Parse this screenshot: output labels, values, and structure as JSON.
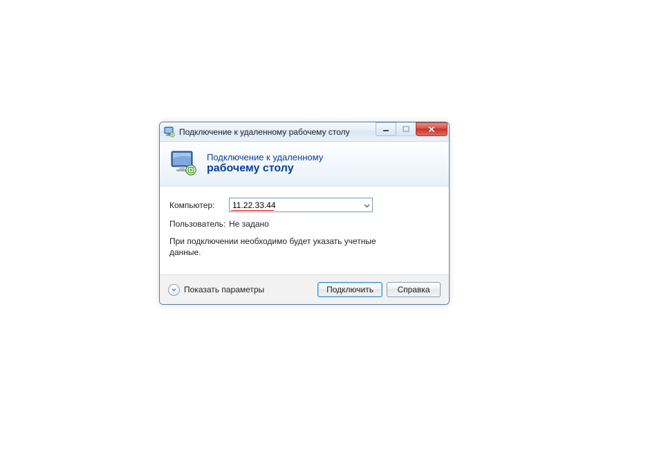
{
  "titlebar": {
    "title": "Подключение к удаленному рабочему столу"
  },
  "header": {
    "line1": "Подключение к удаленному",
    "line2": "рабочему столу"
  },
  "form": {
    "computer_label": "Компьютер:",
    "computer_value": "11.22.33.44",
    "user_label": "Пользователь:",
    "user_value": "Не задано",
    "hint": "При подключении необходимо будет указать учетные данные."
  },
  "footer": {
    "show_options_label": "Показать параметры",
    "connect_label": "Подключить",
    "help_label": "Справка"
  }
}
